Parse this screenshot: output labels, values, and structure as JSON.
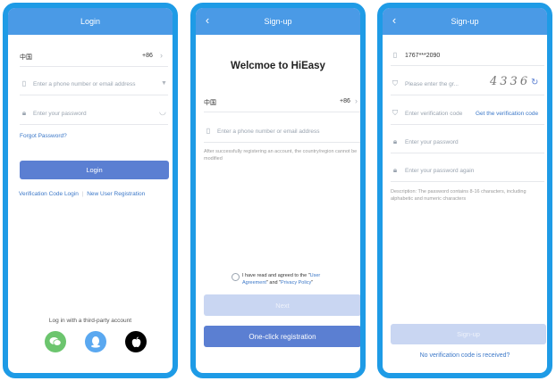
{
  "screen_login": {
    "title": "Login",
    "country_name": "中国",
    "country_code": "+86",
    "phone_placeholder": "Enter a phone number or email address",
    "password_placeholder": "Enter your password",
    "forgot_password": "Forgot Password?",
    "login_button": "Login",
    "verification_login": "Verification Code Login",
    "separator": "|",
    "new_user": "New User Registration",
    "third_party_label": "Log in with a third-party account",
    "icons": [
      "chat-bubble-icon",
      "penguin-icon",
      "apple-icon"
    ],
    "colors": {
      "wechat": "#6cc56e",
      "qq": "#5aa8f0",
      "apple": "#000000"
    }
  },
  "screen_signup": {
    "title": "Sign-up",
    "heading": "Welcmoe to HiEasy",
    "country_name": "中国",
    "country_code": "+86",
    "phone_placeholder": "Enter a phone number or email address",
    "hint": "After successfully registering an account, the country/region cannot be modified",
    "agree_prefix": "I have read and agreed to the \"",
    "agree_link1_a": "User",
    "agree_link1_b": "Agreement",
    "agree_mid": "\" and \"",
    "agree_link2": "Privacy Policy",
    "agree_suffix": "\"",
    "next_button": "Next",
    "one_click_button": "One-click registration"
  },
  "screen_signup2": {
    "title": "Sign-up",
    "phone_value": "1767***2090",
    "graphic_placeholder": "Please enter the gr...",
    "captcha": "4336",
    "verification_placeholder": "Enter verification code",
    "get_code_link": "Get the verification code",
    "password_placeholder": "Enter your password",
    "password_again_placeholder": "Enter your password again",
    "description": "Description: The password contains 8-16 characters, including alphabetic and numeric characters",
    "signup_button": "Sign-up",
    "no_code_link": "No verification code is received?"
  },
  "colors": {
    "frame": "#1e9be6",
    "header": "#4a9ae6",
    "primary_button": "#5b7fd2",
    "disabled_button": "#c9d6f2",
    "link": "#3c78c8"
  }
}
